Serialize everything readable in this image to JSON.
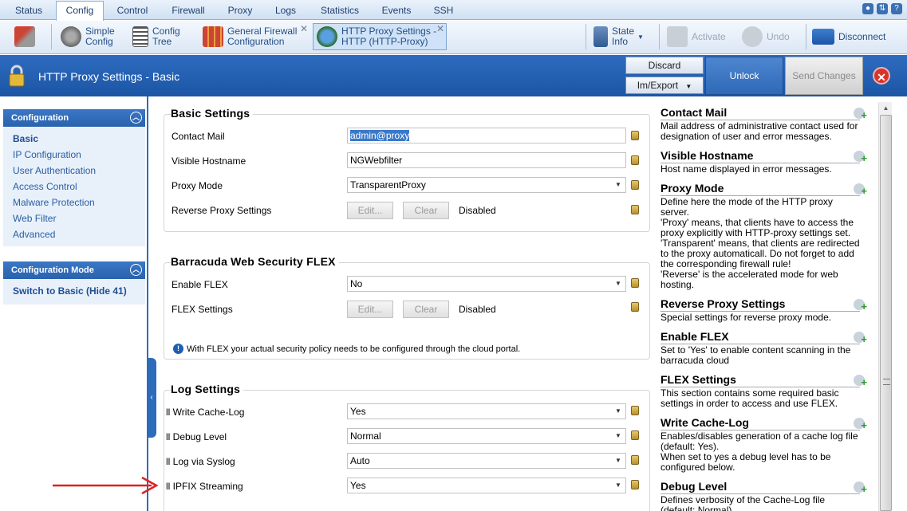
{
  "nav": {
    "tabs": [
      "Status",
      "Config",
      "Control",
      "Firewall",
      "Proxy",
      "Logs",
      "Statistics",
      "Events",
      "SSH"
    ],
    "active": "Config"
  },
  "toolbar": {
    "simple_config": "Simple\nConfig",
    "config_tree": "Config\nTree",
    "general_firewall": "General Firewall\nConfiguration",
    "http_proxy_tab": "HTTP Proxy Settings -\nHTTP (HTTP-Proxy)",
    "state_info": "State\nInfo",
    "activate": "Activate",
    "undo": "Undo",
    "disconnect": "Disconnect"
  },
  "titlebar": {
    "title": "HTTP Proxy Settings - Basic",
    "discard": "Discard",
    "im_export": "Im/Export",
    "unlock": "Unlock",
    "send_changes": "Send Changes"
  },
  "sidebar": {
    "config_header": "Configuration",
    "items": [
      "Basic",
      "IP Configuration",
      "User Authentication",
      "Access Control",
      "Malware Protection",
      "Web Filter",
      "Advanced"
    ],
    "mode_header": "Configuration Mode",
    "mode_item": "Switch to Basic (Hide 41)"
  },
  "basic": {
    "title": "Basic Settings",
    "contact_mail_label": "Contact Mail",
    "contact_mail_value": "admin@proxy",
    "visible_hostname_label": "Visible Hostname",
    "visible_hostname_value": "NGWebfilter",
    "proxy_mode_label": "Proxy Mode",
    "proxy_mode_value": "TransparentProxy",
    "reverse_label": "Reverse Proxy Settings",
    "edit": "Edit...",
    "clear": "Clear",
    "disabled": "Disabled"
  },
  "flex": {
    "title": "Barracuda Web Security FLEX",
    "enable_label": "Enable FLEX",
    "enable_value": "No",
    "settings_label": "FLEX Settings",
    "edit": "Edit...",
    "clear": "Clear",
    "disabled": "Disabled",
    "info": "With FLEX your actual security policy needs to be configured through the cloud portal."
  },
  "log": {
    "title": "Log Settings",
    "cache_label": "ll Write Cache-Log",
    "cache_value": "Yes",
    "debug_label": "ll Debug Level",
    "debug_value": "Normal",
    "syslog_label": "ll Log via Syslog",
    "syslog_value": "Auto",
    "ipfix_label": "ll IPFIX Streaming",
    "ipfix_value": "Yes"
  },
  "help": [
    {
      "title": "Contact Mail",
      "text": "Mail address of administrative contact used for designation of user and error messages."
    },
    {
      "title": "Visible Hostname",
      "text": "Host name displayed in error messages."
    },
    {
      "title": "Proxy Mode",
      "text": "Define here the mode of the HTTP proxy server.\n'Proxy' means, that clients have to access the proxy explicitly with HTTP-proxy settings set.\n'Transparent' means, that clients are redirected to the proxy automaticall. Do not forget to add the corresponding firewall rule!\n'Reverse' is the accelerated mode for web hosting."
    },
    {
      "title": "Reverse Proxy Settings",
      "text": "Special settings for reverse proxy mode."
    },
    {
      "title": "Enable FLEX",
      "text": "Set to 'Yes' to enable content scanning in the barracuda cloud"
    },
    {
      "title": "FLEX Settings",
      "text": "This section contains some required basic settings in order to access and use FLEX."
    },
    {
      "title": "Write Cache-Log",
      "text": "Enables/disables generation of a cache log file (default: Yes).\nWhen set to yes a debug level has to be configured below."
    },
    {
      "title": "Debug Level",
      "text": "Defines verbosity of the Cache-Log file\n(default: Normal)"
    }
  ],
  "colors": {
    "accent": "#2d6cbb",
    "arrow": "#e02020"
  }
}
